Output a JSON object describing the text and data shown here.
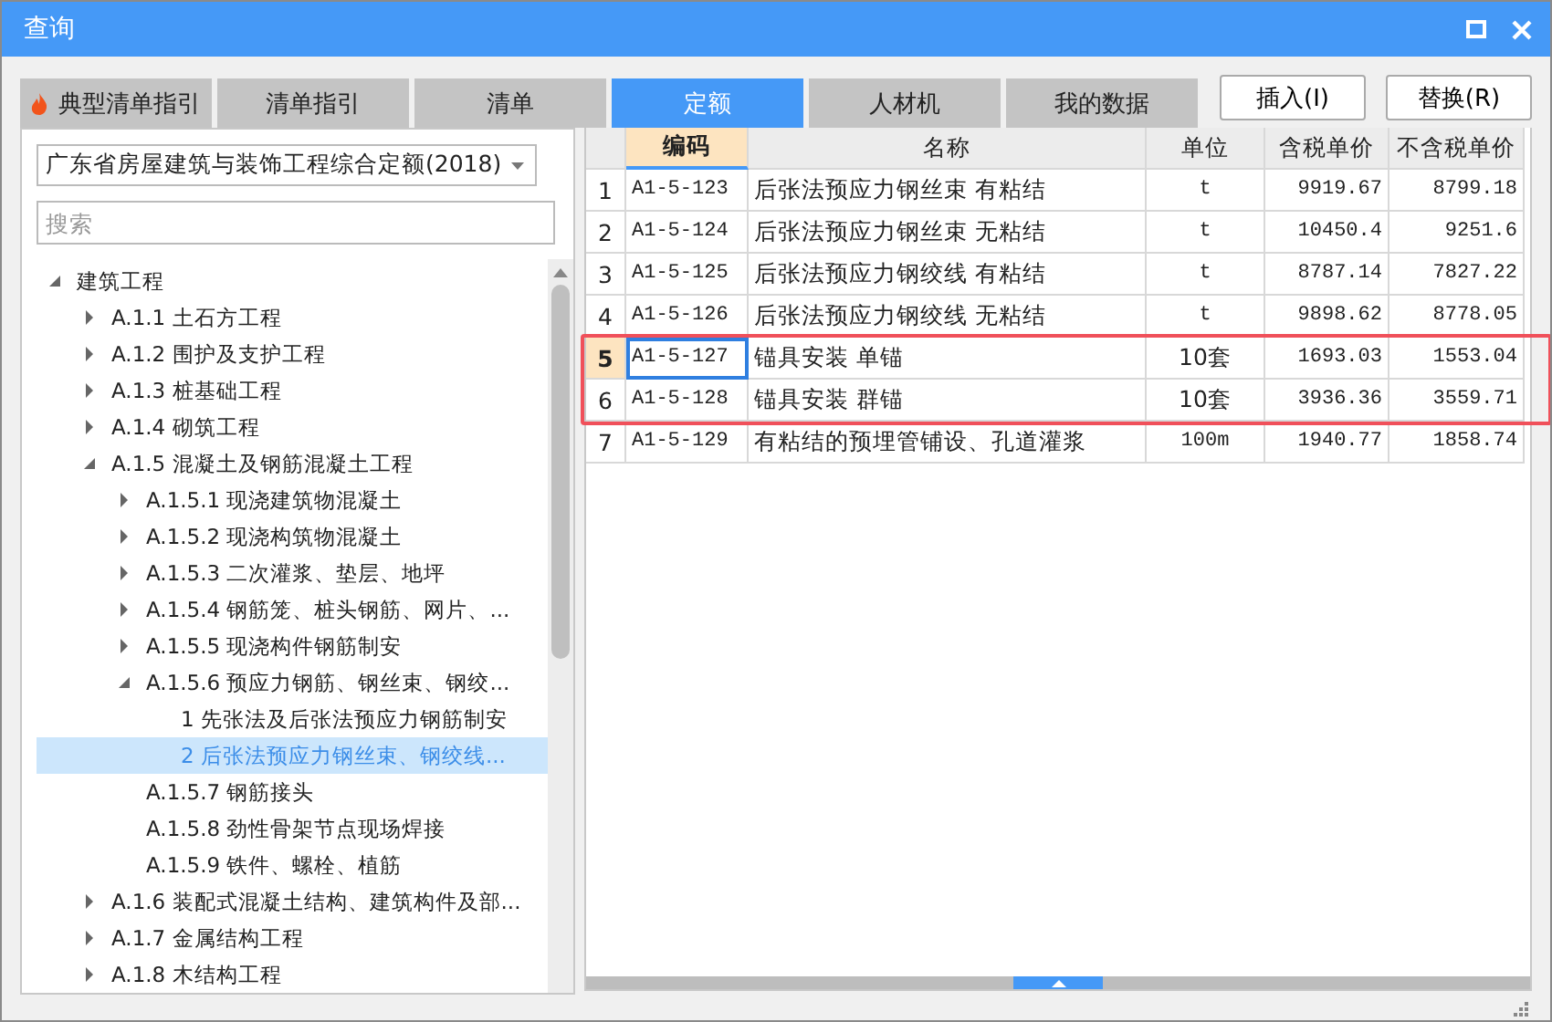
{
  "window": {
    "title": "查询"
  },
  "tabs": [
    {
      "label": "典型清单指引",
      "selected": false,
      "hot": true
    },
    {
      "label": "清单指引",
      "selected": false
    },
    {
      "label": "清单",
      "selected": false
    },
    {
      "label": "定额",
      "selected": true
    },
    {
      "label": "人材机",
      "selected": false
    },
    {
      "label": "我的数据",
      "selected": false
    }
  ],
  "buttons": [
    "插入(I)",
    "替换(R)"
  ],
  "library_select": {
    "value": "广东省房屋建筑与装饰工程综合定额(2018)"
  },
  "search": {
    "placeholder": "搜索"
  },
  "tree": [
    {
      "label": "建筑工程",
      "expanded": true,
      "selected": false,
      "children": [
        {
          "label": "A.1.1 土石方工程",
          "expanded": false,
          "selected": false
        },
        {
          "label": "A.1.2 围护及支护工程",
          "expanded": false,
          "selected": false
        },
        {
          "label": "A.1.3 桩基础工程",
          "expanded": false,
          "selected": false
        },
        {
          "label": "A.1.4 砌筑工程",
          "expanded": false,
          "selected": false
        },
        {
          "label": "A.1.5 混凝土及钢筋混凝土工程",
          "expanded": true,
          "selected": false,
          "children": [
            {
              "label": "A.1.5.1 现浇建筑物混凝土",
              "expanded": false,
              "selected": false
            },
            {
              "label": "A.1.5.2 现浇构筑物混凝土",
              "expanded": false,
              "selected": false
            },
            {
              "label": "A.1.5.3 二次灌浆、垫层、地坪",
              "expanded": false,
              "selected": false
            },
            {
              "label": "A.1.5.4 钢筋笼、桩头钢筋、网片、...",
              "expanded": false,
              "selected": false
            },
            {
              "label": "A.1.5.5 现浇构件钢筋制安",
              "expanded": false,
              "selected": false
            },
            {
              "label": "A.1.5.6 预应力钢筋、钢丝束、钢绞...",
              "expanded": true,
              "selected": false,
              "children": [
                {
                  "label": "1 先张法及后张法预应力钢筋制安",
                  "selected": false
                },
                {
                  "label": "2 后张法预应力钢丝束、钢绞线...",
                  "selected": true
                }
              ]
            },
            {
              "label": "A.1.5.7 钢筋接头",
              "selected": false
            },
            {
              "label": "A.1.5.8 劲性骨架节点现场焊接",
              "selected": false
            },
            {
              "label": "A.1.5.9 铁件、螺栓、植筋",
              "selected": false
            }
          ]
        },
        {
          "label": "A.1.6 装配式混凝土结构、建筑构件及部...",
          "expanded": false,
          "selected": false
        },
        {
          "label": "A.1.7 金属结构工程",
          "expanded": false,
          "selected": false
        },
        {
          "label": "A.1.8 木结构工程",
          "expanded": false,
          "selected": false
        }
      ]
    }
  ],
  "table": {
    "columns": [
      {
        "label": "编码",
        "selected": true
      },
      {
        "label": "名称",
        "selected": false
      },
      {
        "label": "单位",
        "selected": false
      },
      {
        "label": "含税单价",
        "selected": false
      },
      {
        "label": "不含税单价",
        "selected": false
      }
    ],
    "rows": [
      {
        "no": "1",
        "code": "A1-5-123",
        "name": "后张法预应力钢丝束 有粘结",
        "unit": "t",
        "price_tax": "9919.67",
        "price_notax": "8799.18",
        "selected": false,
        "highlighted": false
      },
      {
        "no": "2",
        "code": "A1-5-124",
        "name": "后张法预应力钢丝束 无粘结",
        "unit": "t",
        "price_tax": "10450.4",
        "price_notax": "9251.6",
        "selected": false,
        "highlighted": false
      },
      {
        "no": "3",
        "code": "A1-5-125",
        "name": "后张法预应力钢绞线 有粘结",
        "unit": "t",
        "price_tax": "8787.14",
        "price_notax": "7827.22",
        "selected": false,
        "highlighted": false
      },
      {
        "no": "4",
        "code": "A1-5-126",
        "name": "后张法预应力钢绞线 无粘结",
        "unit": "t",
        "price_tax": "9898.62",
        "price_notax": "8778.05",
        "selected": false,
        "highlighted": false
      },
      {
        "no": "5",
        "code": "A1-5-127",
        "name": "锚具安装 单锚",
        "unit": "10套",
        "price_tax": "1693.03",
        "price_notax": "1553.04",
        "selected": true,
        "highlighted": true
      },
      {
        "no": "6",
        "code": "A1-5-128",
        "name": "锚具安装 群锚",
        "unit": "10套",
        "price_tax": "3936.36",
        "price_notax": "3559.71",
        "selected": false,
        "highlighted": true
      },
      {
        "no": "7",
        "code": "A1-5-129",
        "name": "有粘结的预埋管铺设、孔道灌浆",
        "unit": "100m",
        "price_tax": "1940.77",
        "price_notax": "1858.74",
        "selected": false,
        "highlighted": false
      }
    ]
  }
}
